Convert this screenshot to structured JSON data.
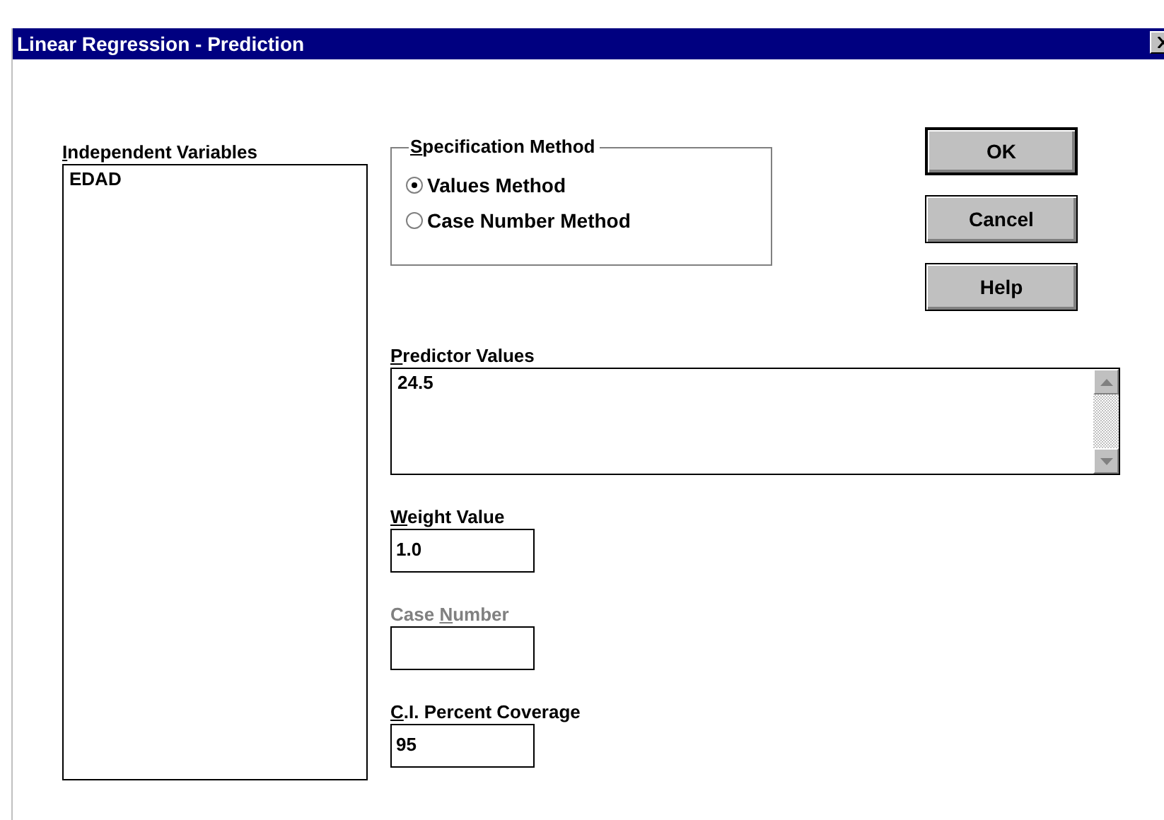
{
  "window": {
    "title": "Linear Regression - Prediction"
  },
  "independent_variables": {
    "label": [
      {
        "text": "I",
        "underlined": true
      },
      {
        "text": "ndependent Variables",
        "underlined": false
      }
    ],
    "items": [
      {
        "text": "EDAD",
        "selected": false
      }
    ]
  },
  "specification_method": {
    "label": [
      {
        "text": "S",
        "underlined": true
      },
      {
        "text": "pecification Method",
        "underlined": false
      }
    ],
    "options": [
      {
        "label": "Values Method",
        "selected": true
      },
      {
        "label": "Case Number Method",
        "selected": false
      }
    ]
  },
  "buttons": [
    {
      "label": "OK",
      "default": true
    },
    {
      "label": "Cancel",
      "default": false
    },
    {
      "label": "Help",
      "default": false
    }
  ],
  "predictor_values": {
    "label": [
      {
        "text": "P",
        "underlined": true
      },
      {
        "text": "redictor Values",
        "underlined": false
      }
    ],
    "value": "24.5"
  },
  "fields": [
    {
      "label": [
        {
          "text": "W",
          "underlined": true
        },
        {
          "text": "eight Value",
          "underlined": false
        }
      ],
      "value": "1.0",
      "disabled": false
    },
    {
      "label": [
        {
          "text": "Case ",
          "underlined": false
        },
        {
          "text": "N",
          "underlined": true
        },
        {
          "text": "umber",
          "underlined": false
        }
      ],
      "disabled": true
    },
    {
      "label": [
        {
          "text": "C",
          "underlined": true
        },
        {
          "text": ".I. Percent Coverage",
          "underlined": false
        }
      ],
      "value": "95",
      "disabled": false
    }
  ]
}
